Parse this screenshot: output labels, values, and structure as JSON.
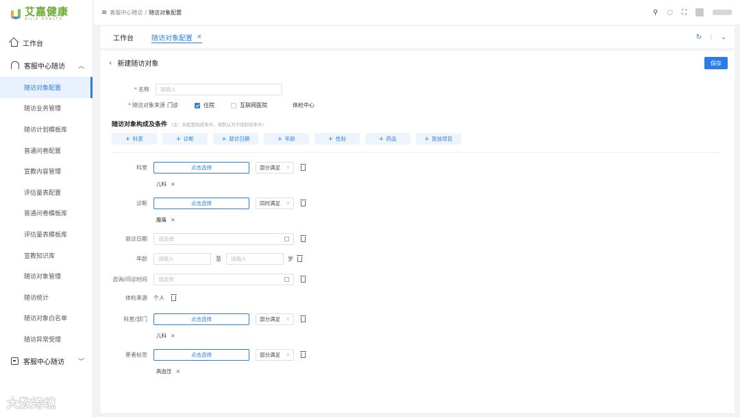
{
  "brand": {
    "name_cn": "艾嘉健康",
    "name_en": "AIJIA HEALTH"
  },
  "sidebar": {
    "top_item": "工作台",
    "group1": "客服中心随访",
    "items": [
      "随访对象配置",
      "随访业务管理",
      "随访计划模板库",
      "普通问卷配置",
      "宣教内容管理",
      "评估量表配置",
      "普通问卷模板库",
      "评估量表模板库",
      "宣教知识库",
      "随访对象管理",
      "随访统计",
      "随访对象白名单",
      "随访异常受理"
    ],
    "active_index": 0,
    "group2": "客服中心随访"
  },
  "header": {
    "breadcrumb_parent": "客服中心随访",
    "breadcrumb_sep": "/",
    "breadcrumb_current": "随访对象配置"
  },
  "tabs": [
    {
      "label": "工作台"
    },
    {
      "label": "随访对象配置",
      "close": "×"
    }
  ],
  "page": {
    "back": "‹",
    "title": "新建随访对象",
    "save": "保存"
  },
  "form": {
    "name_label": "名称",
    "name_placeholder": "请输入",
    "source_label": "随访对象来源",
    "sources": [
      {
        "label": "门诊",
        "checked": false
      },
      {
        "label": "住院",
        "checked": true
      },
      {
        "label": "互联网医院",
        "checked": false
      },
      {
        "label": "体检中心",
        "checked": false
      }
    ],
    "section_title": "随访对象构成及条件",
    "section_note": "(注：未配置构成条件，将默认为不限制该条件)",
    "add_buttons": [
      "科室",
      "诊断",
      "就诊日期",
      "年龄",
      "性别",
      "药品",
      "医技项目"
    ],
    "plus": "+",
    "pick_text": "点击选择",
    "conditions": {
      "dept": {
        "label": "科室",
        "mode": "部分满足",
        "tag": "儿科"
      },
      "diag": {
        "label": "诊断",
        "mode": "同时满足",
        "tag": "腹痛"
      },
      "date": {
        "label": "就诊日期",
        "placeholder": "请选择"
      },
      "age": {
        "label": "年龄",
        "from_placeholder": "请输入",
        "to": "至",
        "to_placeholder": "请输入",
        "unit": "岁"
      },
      "consult": {
        "label": "咨询/问诊时间",
        "placeholder": "请选择"
      },
      "exam": {
        "label": "体检来源",
        "value": "个人"
      },
      "dept2": {
        "label": "科室/部门",
        "mode": "部分满足",
        "tag": "儿科"
      },
      "ptag": {
        "label": "患者标签",
        "mode": "部分满足",
        "tag": "高血压"
      }
    },
    "tag_close": "×"
  },
  "watermark": "大数跨境"
}
